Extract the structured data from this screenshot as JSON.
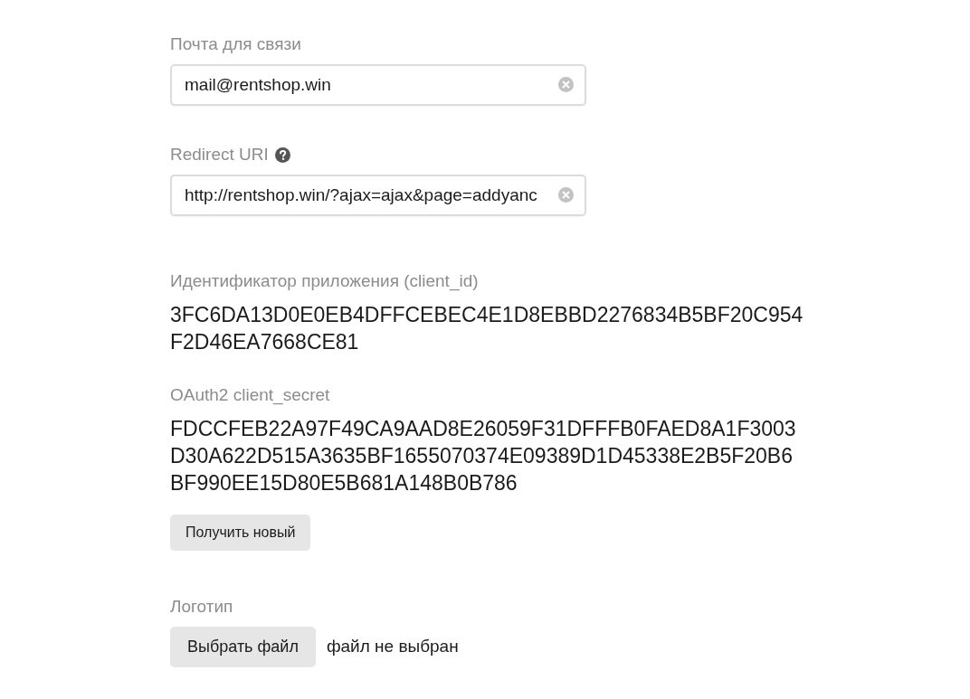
{
  "fields": [
    {
      "kind": "input",
      "label": "Почта для связи",
      "value": "mail@rentshop.win",
      "clearable": true
    },
    {
      "kind": "input",
      "label": "Redirect URI",
      "help": true,
      "value": "http://rentshop.win/?ajax=ajax&page=addyanc",
      "clearable": true
    },
    {
      "kind": "readonly",
      "label": "Идентификатор приложения (client_id)",
      "value": "3FC6DA13D0E0EB4DFFCEBEC4E1D8EBBD2276834B5BF20C954F2D46EA7668CE81"
    },
    {
      "kind": "readonly",
      "label": "OAuth2 client_secret",
      "value": "FDCCFEB22A97F49CA9AAD8E26059F31DFFFB0FAED8A1F3003D30A622D515A3635BF1655070374E09389D1D45338E2B5F20B6BF990EE15D80E5B681A148B0B786",
      "button": "Получить новый"
    },
    {
      "kind": "file",
      "label": "Логотип",
      "button": "Выбрать файл",
      "status": "файл не выбран"
    }
  ]
}
